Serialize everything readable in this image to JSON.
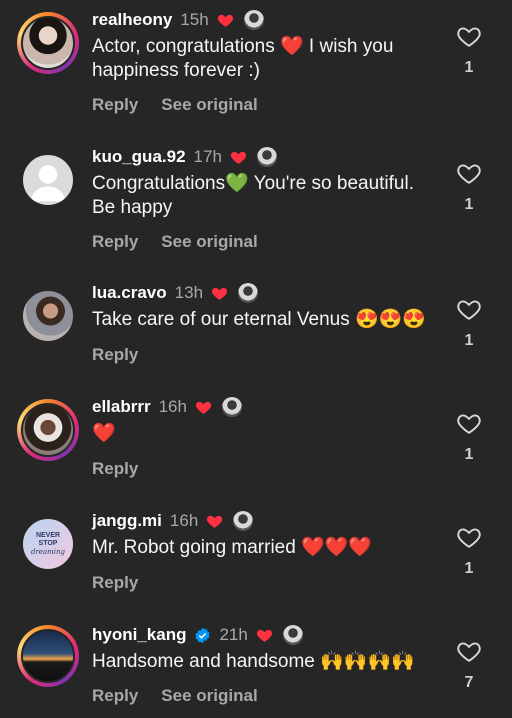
{
  "comments": [
    {
      "username": "realheony",
      "time": "15h",
      "text": "Actor, congratulations ❤️ I wish you happiness forever :)",
      "actions": [
        "Reply",
        "See original"
      ],
      "likes": "1",
      "avatar": "avatar-photo"
    },
    {
      "username": "kuo_gua.92",
      "time": "17h",
      "text": "Congratulations💚 You're so beautiful. Be happy",
      "actions": [
        "Reply",
        "See original"
      ],
      "likes": "1",
      "avatar": "avatar-default"
    },
    {
      "username": "lua.cravo",
      "time": "13h",
      "text": "Take care of our eternal Venus 😍😍😍",
      "actions": [
        "Reply"
      ],
      "likes": "1",
      "avatar": "avatar-photo"
    },
    {
      "username": "ellabrrr",
      "time": "16h",
      "text": "❤️",
      "actions": [
        "Reply"
      ],
      "likes": "1",
      "avatar": "avatar-photo"
    },
    {
      "username": "jangg.mi",
      "time": "16h",
      "text": "Mr. Robot going married ❤️❤️❤️",
      "actions": [
        "Reply"
      ],
      "likes": "1",
      "avatar": "never-stop-dreaming",
      "avatar_text": [
        "NEVER",
        "STOP",
        "dreaming"
      ]
    },
    {
      "username": "hyoni_kang",
      "time": "21h",
      "text": "Handsome and handsome 🙌🙌🙌🙌",
      "actions": [
        "Reply",
        "See original"
      ],
      "likes": "7",
      "avatar": "sunset-photo",
      "verified": true
    }
  ],
  "colors": {
    "background": "#262626",
    "heart_red": "#ff3040",
    "secondary_text": "#a8a8a8",
    "verified_blue": "#0095f6"
  }
}
